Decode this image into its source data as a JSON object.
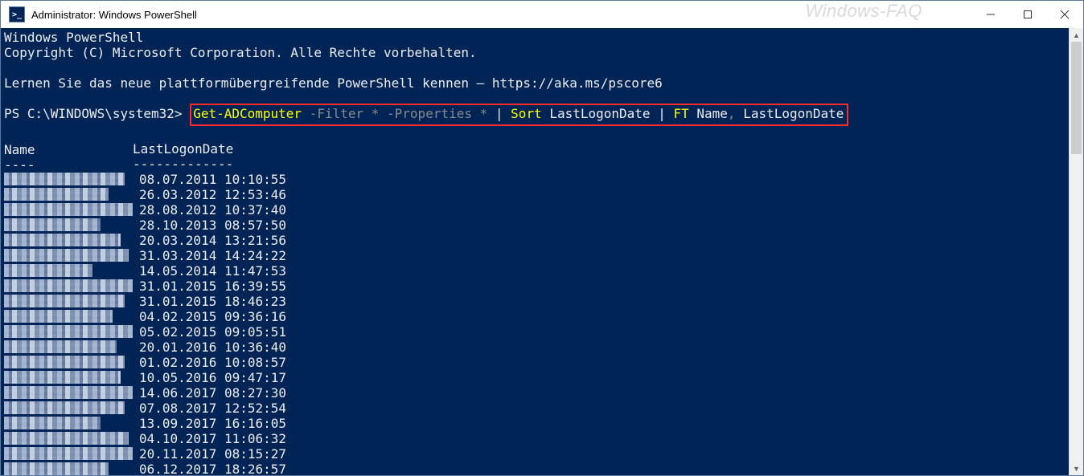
{
  "titlebar": {
    "icon_glyph": ">_",
    "title": "Administrator: Windows PowerShell",
    "watermark": "Windows-FAQ"
  },
  "console": {
    "banner_line1": "Windows PowerShell",
    "banner_line2": "Copyright (C) Microsoft Corporation. Alle Rechte vorbehalten.",
    "hint_line": "Lernen Sie das neue plattformübergreifende PowerShell kennen – https://aka.ms/pscore6",
    "prompt": "PS C:\\WINDOWS\\system32>",
    "command": {
      "cmdlet1": "Get-ADComputer",
      "params": " -Filter * -Properties * ",
      "pipe1": "|",
      "cmdlet2": "Sort",
      "arg2": " LastLogonDate ",
      "pipe2": "|",
      "cmdlet3": "FT",
      "arg3a": " Name",
      "comma": ",",
      "arg3b": " LastLogonDate"
    },
    "columns": {
      "name_header": "Name",
      "date_header": "LastLogonDate",
      "name_underline": "----",
      "date_underline": "-------------"
    },
    "rows": [
      {
        "date": "08.07.2011 10:10:55"
      },
      {
        "date": "26.03.2012 12:53:46"
      },
      {
        "date": "28.08.2012 10:37:40"
      },
      {
        "date": "28.10.2013 08:57:50"
      },
      {
        "date": "20.03.2014 13:21:56"
      },
      {
        "date": "31.03.2014 14:24:22"
      },
      {
        "date": "14.05.2014 11:47:53"
      },
      {
        "date": "31.01.2015 16:39:55"
      },
      {
        "date": "31.01.2015 18:46:23"
      },
      {
        "date": "04.02.2015 09:36:16"
      },
      {
        "date": "05.02.2015 09:05:51"
      },
      {
        "date": "20.01.2016 10:36:40"
      },
      {
        "date": "01.02.2016 10:08:57"
      },
      {
        "date": "10.05.2016 09:47:17"
      },
      {
        "date": "14.06.2017 08:27:30"
      },
      {
        "date": "07.08.2017 12:52:54"
      },
      {
        "date": "13.09.2017 16:16:05"
      },
      {
        "date": "04.10.2017 11:06:32"
      },
      {
        "date": "20.11.2017 08:15:27"
      },
      {
        "date": "06.12.2017 18:26:57"
      }
    ]
  }
}
